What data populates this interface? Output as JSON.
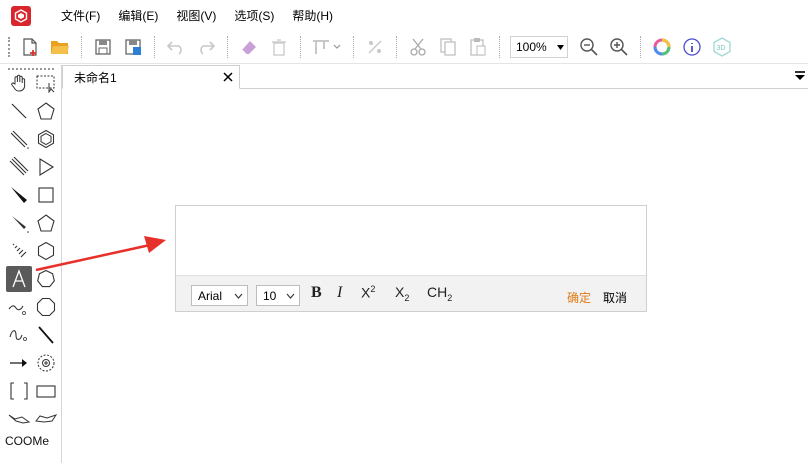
{
  "menu": [
    "文件(F)",
    "编辑(E)",
    "视图(V)",
    "选项(S)",
    "帮助(H)"
  ],
  "toolbar": {
    "zoom": "100%",
    "icons": [
      "new-file-icon",
      "open-folder-icon",
      "save-icon",
      "save-as-icon",
      "undo-icon",
      "redo-icon",
      "eraser-icon",
      "delete-icon",
      "align-icon",
      "flip-icon",
      "cut-icon",
      "copy-icon",
      "paste-icon",
      "zoom-out-icon",
      "zoom-in-icon",
      "color-icon",
      "info-icon",
      "3d-icon"
    ]
  },
  "tab": {
    "label": "未命名1"
  },
  "palette": {
    "text_tool_label": "COOMe"
  },
  "editor": {
    "font": "Arial",
    "size": "10",
    "bold": "B",
    "italic": "I",
    "superscript_base": "X",
    "superscript_sup": "2",
    "subscript_base": "X",
    "subscript_sub": "2",
    "formula_base": "CH",
    "formula_sub": "2",
    "ok": "确定",
    "cancel": "取消"
  },
  "colors": {
    "accent": "#d8262c",
    "ok": "#e07b1a",
    "arrow": "#e8302a"
  }
}
